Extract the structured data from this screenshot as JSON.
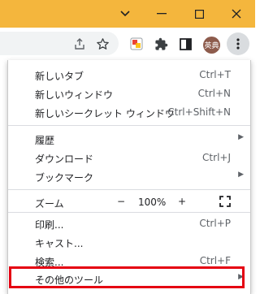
{
  "window": {
    "controls": [
      {
        "icon": "chevron-down-icon"
      },
      {
        "icon": "minimize-icon",
        "glyph": "—"
      },
      {
        "icon": "maximize-icon"
      },
      {
        "icon": "close-icon",
        "glyph": "✕"
      }
    ]
  },
  "toolbar": {
    "avatar_text": "英典",
    "icons": [
      "share-icon",
      "bookmark-star-icon",
      "extension-app-icon",
      "puzzle-extensions-icon",
      "side-panel-icon"
    ]
  },
  "menu": {
    "new_tab": {
      "label": "新しいタブ",
      "shortcut": "Ctrl+T"
    },
    "new_window": {
      "label": "新しいウィンドウ",
      "shortcut": "Ctrl+N"
    },
    "new_incognito": {
      "label": "新しいシークレット ウィンドウ",
      "shortcut": "Ctrl+Shift+N"
    },
    "history": {
      "label": "履歴"
    },
    "downloads": {
      "label": "ダウンロード",
      "shortcut": "Ctrl+J"
    },
    "bookmarks": {
      "label": "ブックマーク"
    },
    "zoom": {
      "label": "ズーム",
      "minus": "−",
      "value": "100%",
      "plus": "+"
    },
    "print": {
      "label": "印刷...",
      "shortcut": "Ctrl+P"
    },
    "cast": {
      "label": "キャスト..."
    },
    "find": {
      "label": "検索...",
      "shortcut": "Ctrl+F"
    },
    "more_tools": {
      "label": "その他のツール"
    }
  },
  "colors": {
    "titlebar": "#f4b63d",
    "highlight_box": "#e50012",
    "avatar": "#8d5b4c"
  }
}
